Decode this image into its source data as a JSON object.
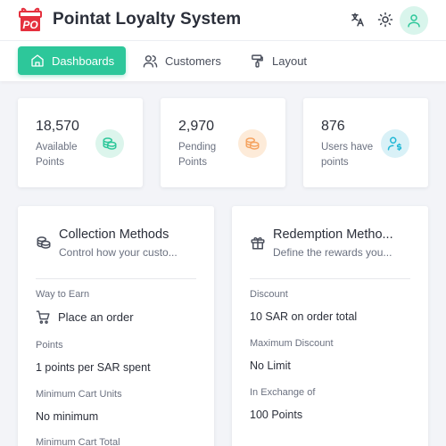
{
  "app": {
    "title": "Pointat Loyalty System",
    "logo_text": "PO"
  },
  "header": {
    "icons": [
      "translate-icon",
      "sun-icon",
      "user-icon"
    ]
  },
  "nav": {
    "items": [
      {
        "label": "Dashboards",
        "icon": "home-icon",
        "active": true
      },
      {
        "label": "Customers",
        "icon": "users-icon",
        "active": false
      },
      {
        "label": "Layout",
        "icon": "paint-roller-icon",
        "active": false
      }
    ]
  },
  "stats": [
    {
      "value": "18,570",
      "label": "Available Points",
      "icon": "coins-icon",
      "color": "#2dc79a"
    },
    {
      "value": "2,970",
      "label": "Pending Points",
      "icon": "coins-icon",
      "color": "#f5a462"
    },
    {
      "value": "876",
      "label": "Users have points",
      "icon": "user-dollar-icon",
      "color": "#22b8d6"
    }
  ],
  "collection": {
    "title": "Collection Methods",
    "subtitle": "Control how your custo...",
    "way_label": "Way to Earn",
    "way_value": "Place an order",
    "points_label": "Points",
    "points_value": "1 points per SAR spent",
    "min_units_label": "Minimum Cart Units",
    "min_units_value": "No minimum",
    "min_total_label": "Minimum Cart Total"
  },
  "redemption": {
    "title": "Redemption Metho...",
    "subtitle": "Define the rewards you...",
    "discount_label": "Discount",
    "discount_value": "10 SAR on order total",
    "max_label": "Maximum Discount",
    "max_value": "No Limit",
    "exchange_label": "In Exchange of",
    "exchange_value": "100 Points"
  },
  "colors": {
    "accent": "#2dc79a",
    "brand": "#e5303e",
    "background": "#f3f4f8"
  }
}
